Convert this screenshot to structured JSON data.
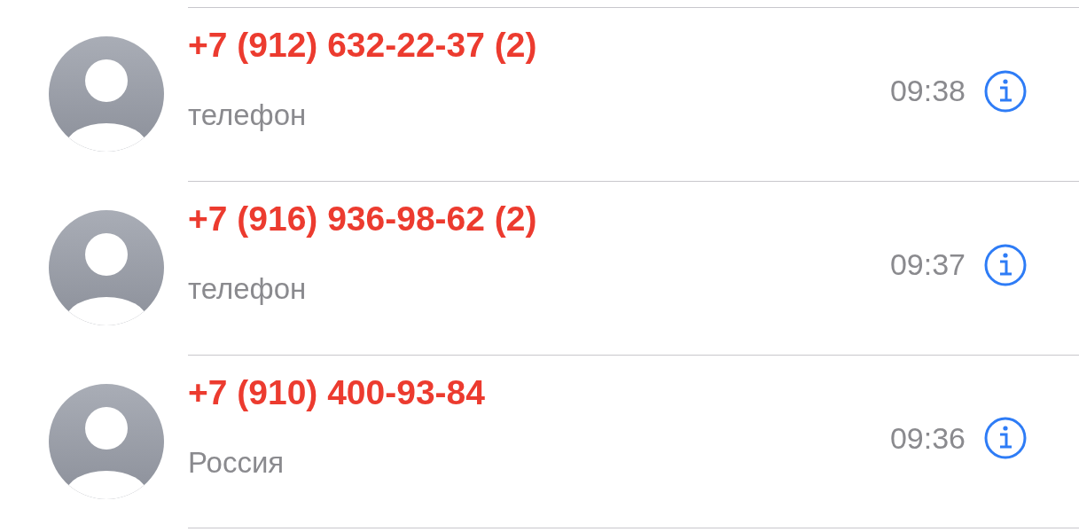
{
  "calls": [
    {
      "number": "+7 (912) 632-22-37 (2)",
      "label": "телефон",
      "time": "09:38",
      "missed": true
    },
    {
      "number": "+7 (916) 936-98-62 (2)",
      "label": "телефон",
      "time": "09:37",
      "missed": true
    },
    {
      "number": "+7 (910) 400-93-84",
      "label": "Россия",
      "time": "09:36",
      "missed": true
    }
  ]
}
